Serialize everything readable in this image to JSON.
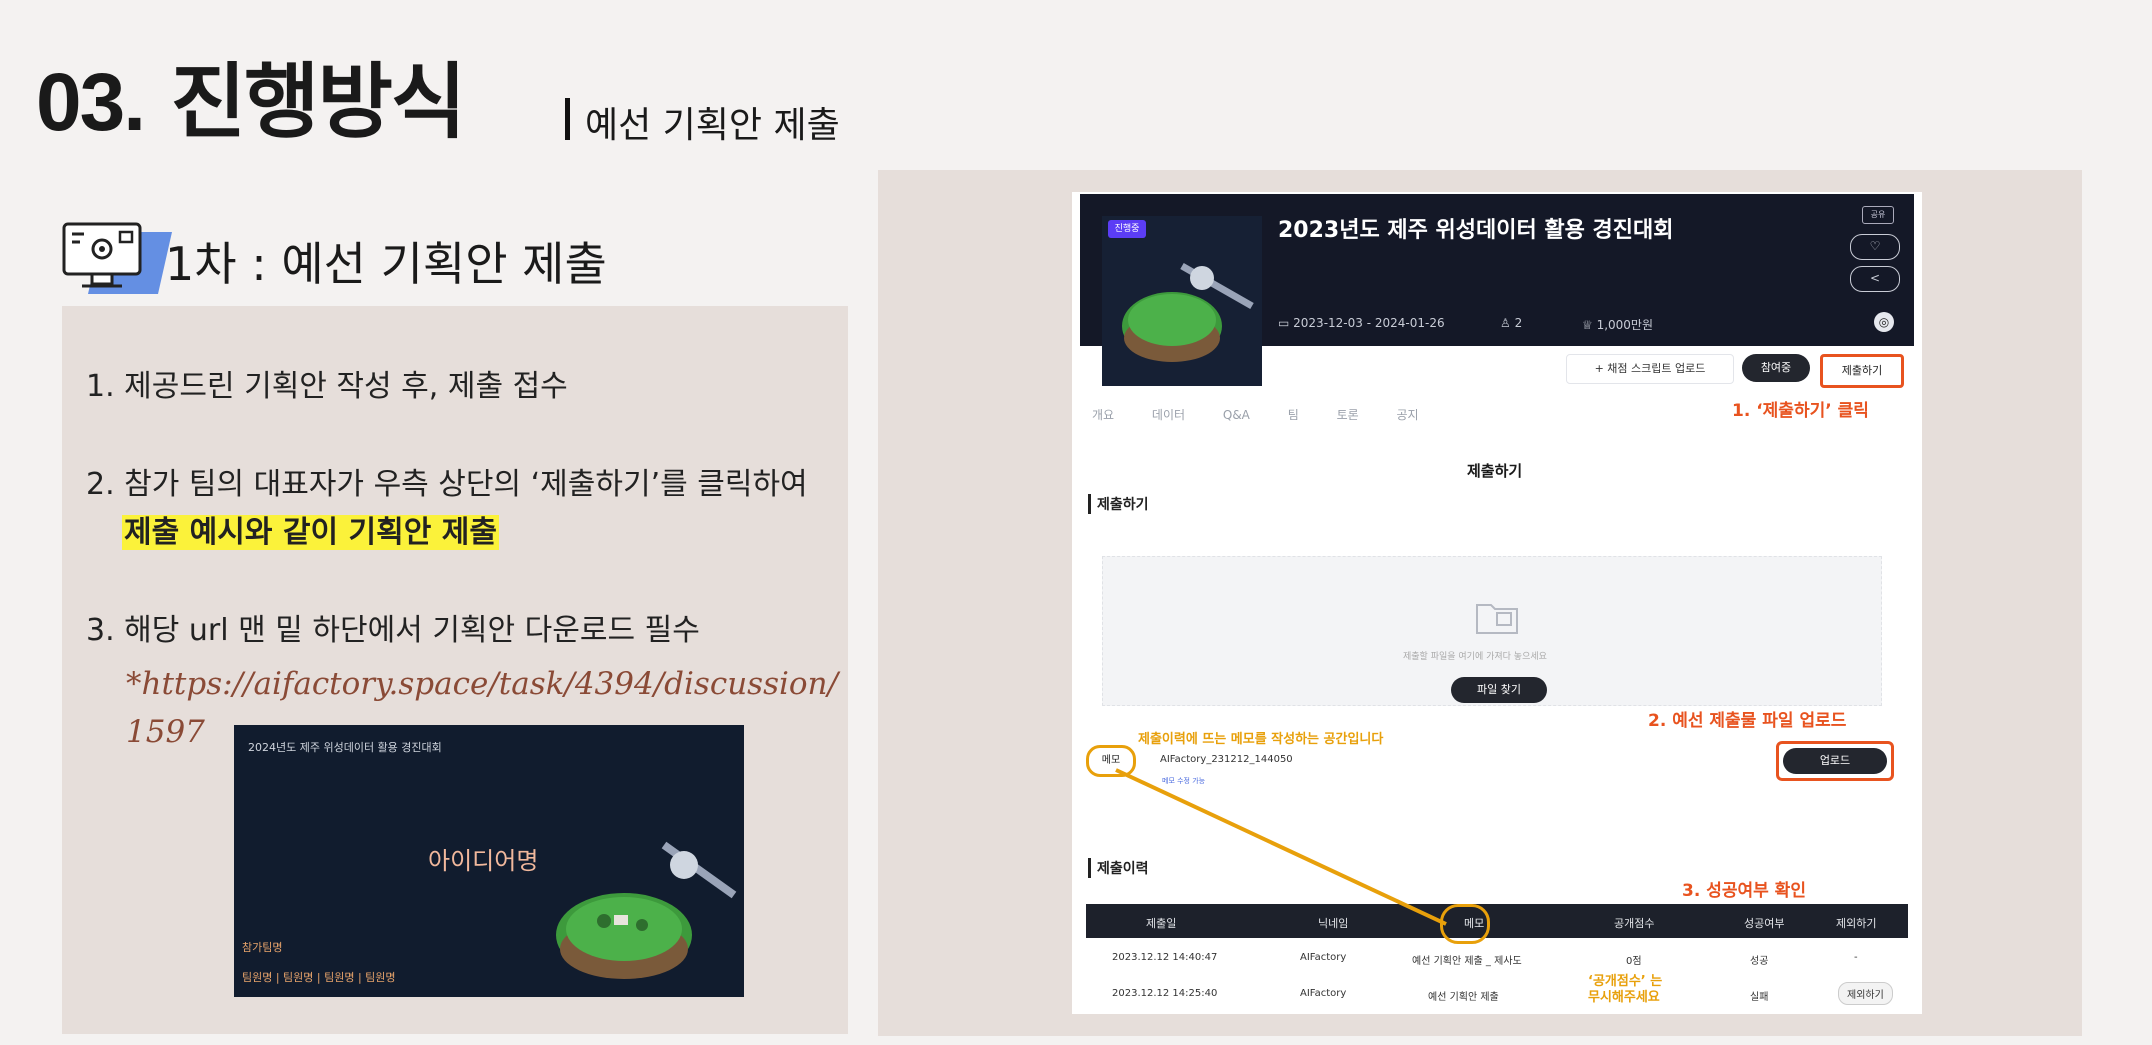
{
  "header": {
    "number": "03.",
    "title": "진행방식",
    "subtitle": "예선 기획안 제출"
  },
  "step": {
    "title": "1차 : 예선 기획안 제출",
    "icon": "computer-settings-icon"
  },
  "instructions": {
    "item1": "1.  제공드린 기획안 작성 후, 제출 접수",
    "item2": "2.  참가 팀의 대표자가 우측 상단의 ‘제출하기’를 클릭하여",
    "item2_highlight": "제출 예시와 같이 기획안 제출",
    "item3": "3.  해당 url 맨 밑 하단에서 기획안 다운로드 필수",
    "link": "*https://aifactory.space/task/4394/discussion/1597"
  },
  "thumbnail": {
    "header": "2024년도 제주 위성데이터 활용 경진대회",
    "idea": "아이디어명",
    "team_label": "참가팀명",
    "members": "팀원명 | 팀원명 | 팀원명 | 팀원명"
  },
  "screenshot": {
    "badge": "진행중",
    "title": "2023년도 제주 위성데이터 활용 경진대회",
    "dates": "2023-12-03 - 2024-01-26",
    "participants": "2",
    "prize": "1,000만원",
    "share_label": "공유",
    "side_buttons": [
      "♡",
      "<",
      "◎"
    ],
    "upload_script_btn": "+ 채점 스크립트 업로드",
    "joined_btn": "참여중",
    "submit_btn": "제출하기",
    "tabs": [
      "개요",
      "데이터",
      "Q&A",
      "팀",
      "토론",
      "공지"
    ],
    "section_title": "제출하기",
    "section_head": "제출하기",
    "drop_text": "제출할 파일을 여기에 가져다 놓으세요",
    "find_file_btn": "파일 찾기",
    "memo_label": "메모",
    "memo_value": "AIFactory_231212_144050",
    "memo_sub": "메모 수정 가능",
    "upload_btn": "업로드",
    "history_head": "제출이력",
    "table_headers": [
      "제출일",
      "닉네임",
      "메모",
      "공개점수",
      "성공여부",
      "제외하기"
    ],
    "rows": [
      {
        "date": "2023.12.12 14:40:47",
        "nick": "AIFactory",
        "memo": "예선 기획안 제출 _ 제사도",
        "score": "0점",
        "status": "성공",
        "action": "-"
      },
      {
        "date": "2023.12.12 14:25:40",
        "nick": "AIFactory",
        "memo": "예선 기획안 제출",
        "score": "",
        "status": "실패",
        "action": "제외하기"
      }
    ]
  },
  "annotations": {
    "a1": "1. ‘제출하기’ 클릭",
    "a2": "2. 예선 제출물 파일 업로드",
    "a3": "3. 성공여부 확인",
    "memo_note": "제출이력에 뜨는 메모를 작성하는 공간입니다",
    "score_note_1": "‘공개점수’ 는",
    "score_note_2": "무시해주세요"
  },
  "colors": {
    "accent": "#e8531f",
    "note": "#e8a00b",
    "highlight": "#fbf23a"
  }
}
